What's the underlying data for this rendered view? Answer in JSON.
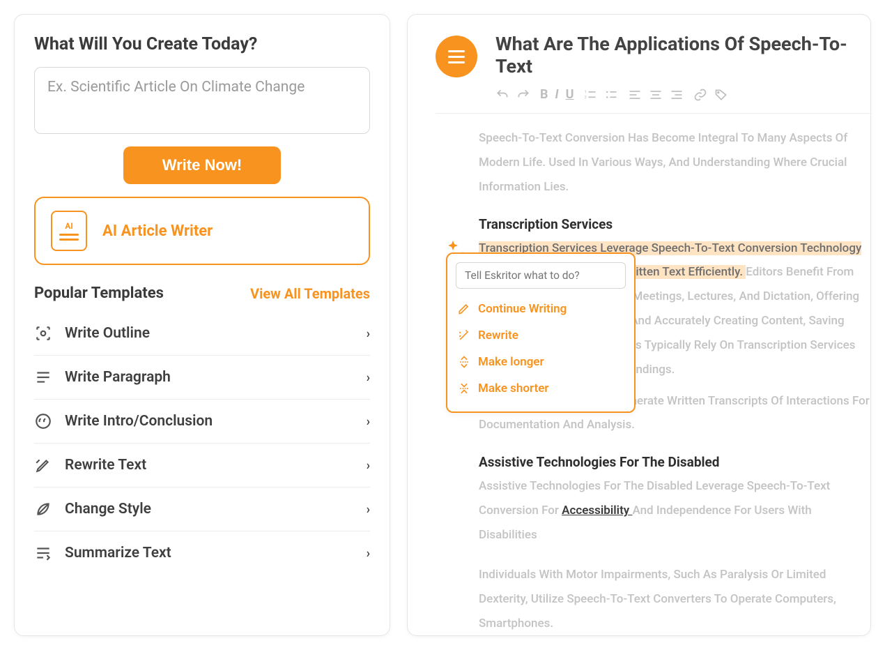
{
  "left": {
    "heading": "What Will You Create Today?",
    "placeholder": "Ex. Scientific Article On Climate Change",
    "write_btn": "Write Now!",
    "ai_card_label": "AI Article Writer",
    "templates_title": "Popular Templates",
    "view_all": "View All Templates",
    "templates": [
      {
        "label": "Write Outline"
      },
      {
        "label": "Write Paragraph"
      },
      {
        "label": "Write Intro/Conclusion"
      },
      {
        "label": "Rewrite Text"
      },
      {
        "label": "Change Style"
      },
      {
        "label": "Summarize Text"
      }
    ]
  },
  "right": {
    "title": "What Are The Applications Of Speech-To-Text",
    "intro": "Speech-To-Text Conversion Has Become Integral To Many Aspects Of Modern Life. Used In Various Ways, And Understanding Where Crucial Information Lies.",
    "section1_head": "Transcription Services",
    "section1_hl": "Transcription Services Leverage Speech-To-Text Conversion Technology To Turn Spoken Audio Into Written Text Efficiently. ",
    "section1_rest": "Editors Benefit From Transcription For Interviews, Meetings, Lectures, And Dictation, Offering The Convenience Of Quickly And Accurately Creating Content, Saving Time And Effort. Professionals Typically Rely On Transcription Services To Create Written Research Findings.",
    "section1_para2": "Transcription Services To Generate Written Transcripts Of Interactions For Documentation And Analysis.",
    "section2_head": "Assistive Technologies For The Disabled",
    "section2_p1a": "Assistive Technologies For The Disabled Leverage Speech-To-Text Conversion For ",
    "section2_p1_link": "Accessibility ",
    "section2_p1b": "And Independence For Users With Disabilities",
    "section2_p2": "Individuals With Motor Impairments, Such As Paralysis Or Limited Dexterity, Utilize Speech-To-Text Converters To Operate Computers, Smartphones."
  },
  "popup": {
    "placeholder": "Tell Eskritor what to do?",
    "items": [
      {
        "label": "Continue Writing"
      },
      {
        "label": "Rewrite"
      },
      {
        "label": "Make longer"
      },
      {
        "label": "Make shorter"
      }
    ]
  },
  "colors": {
    "accent": "#f7931e"
  }
}
